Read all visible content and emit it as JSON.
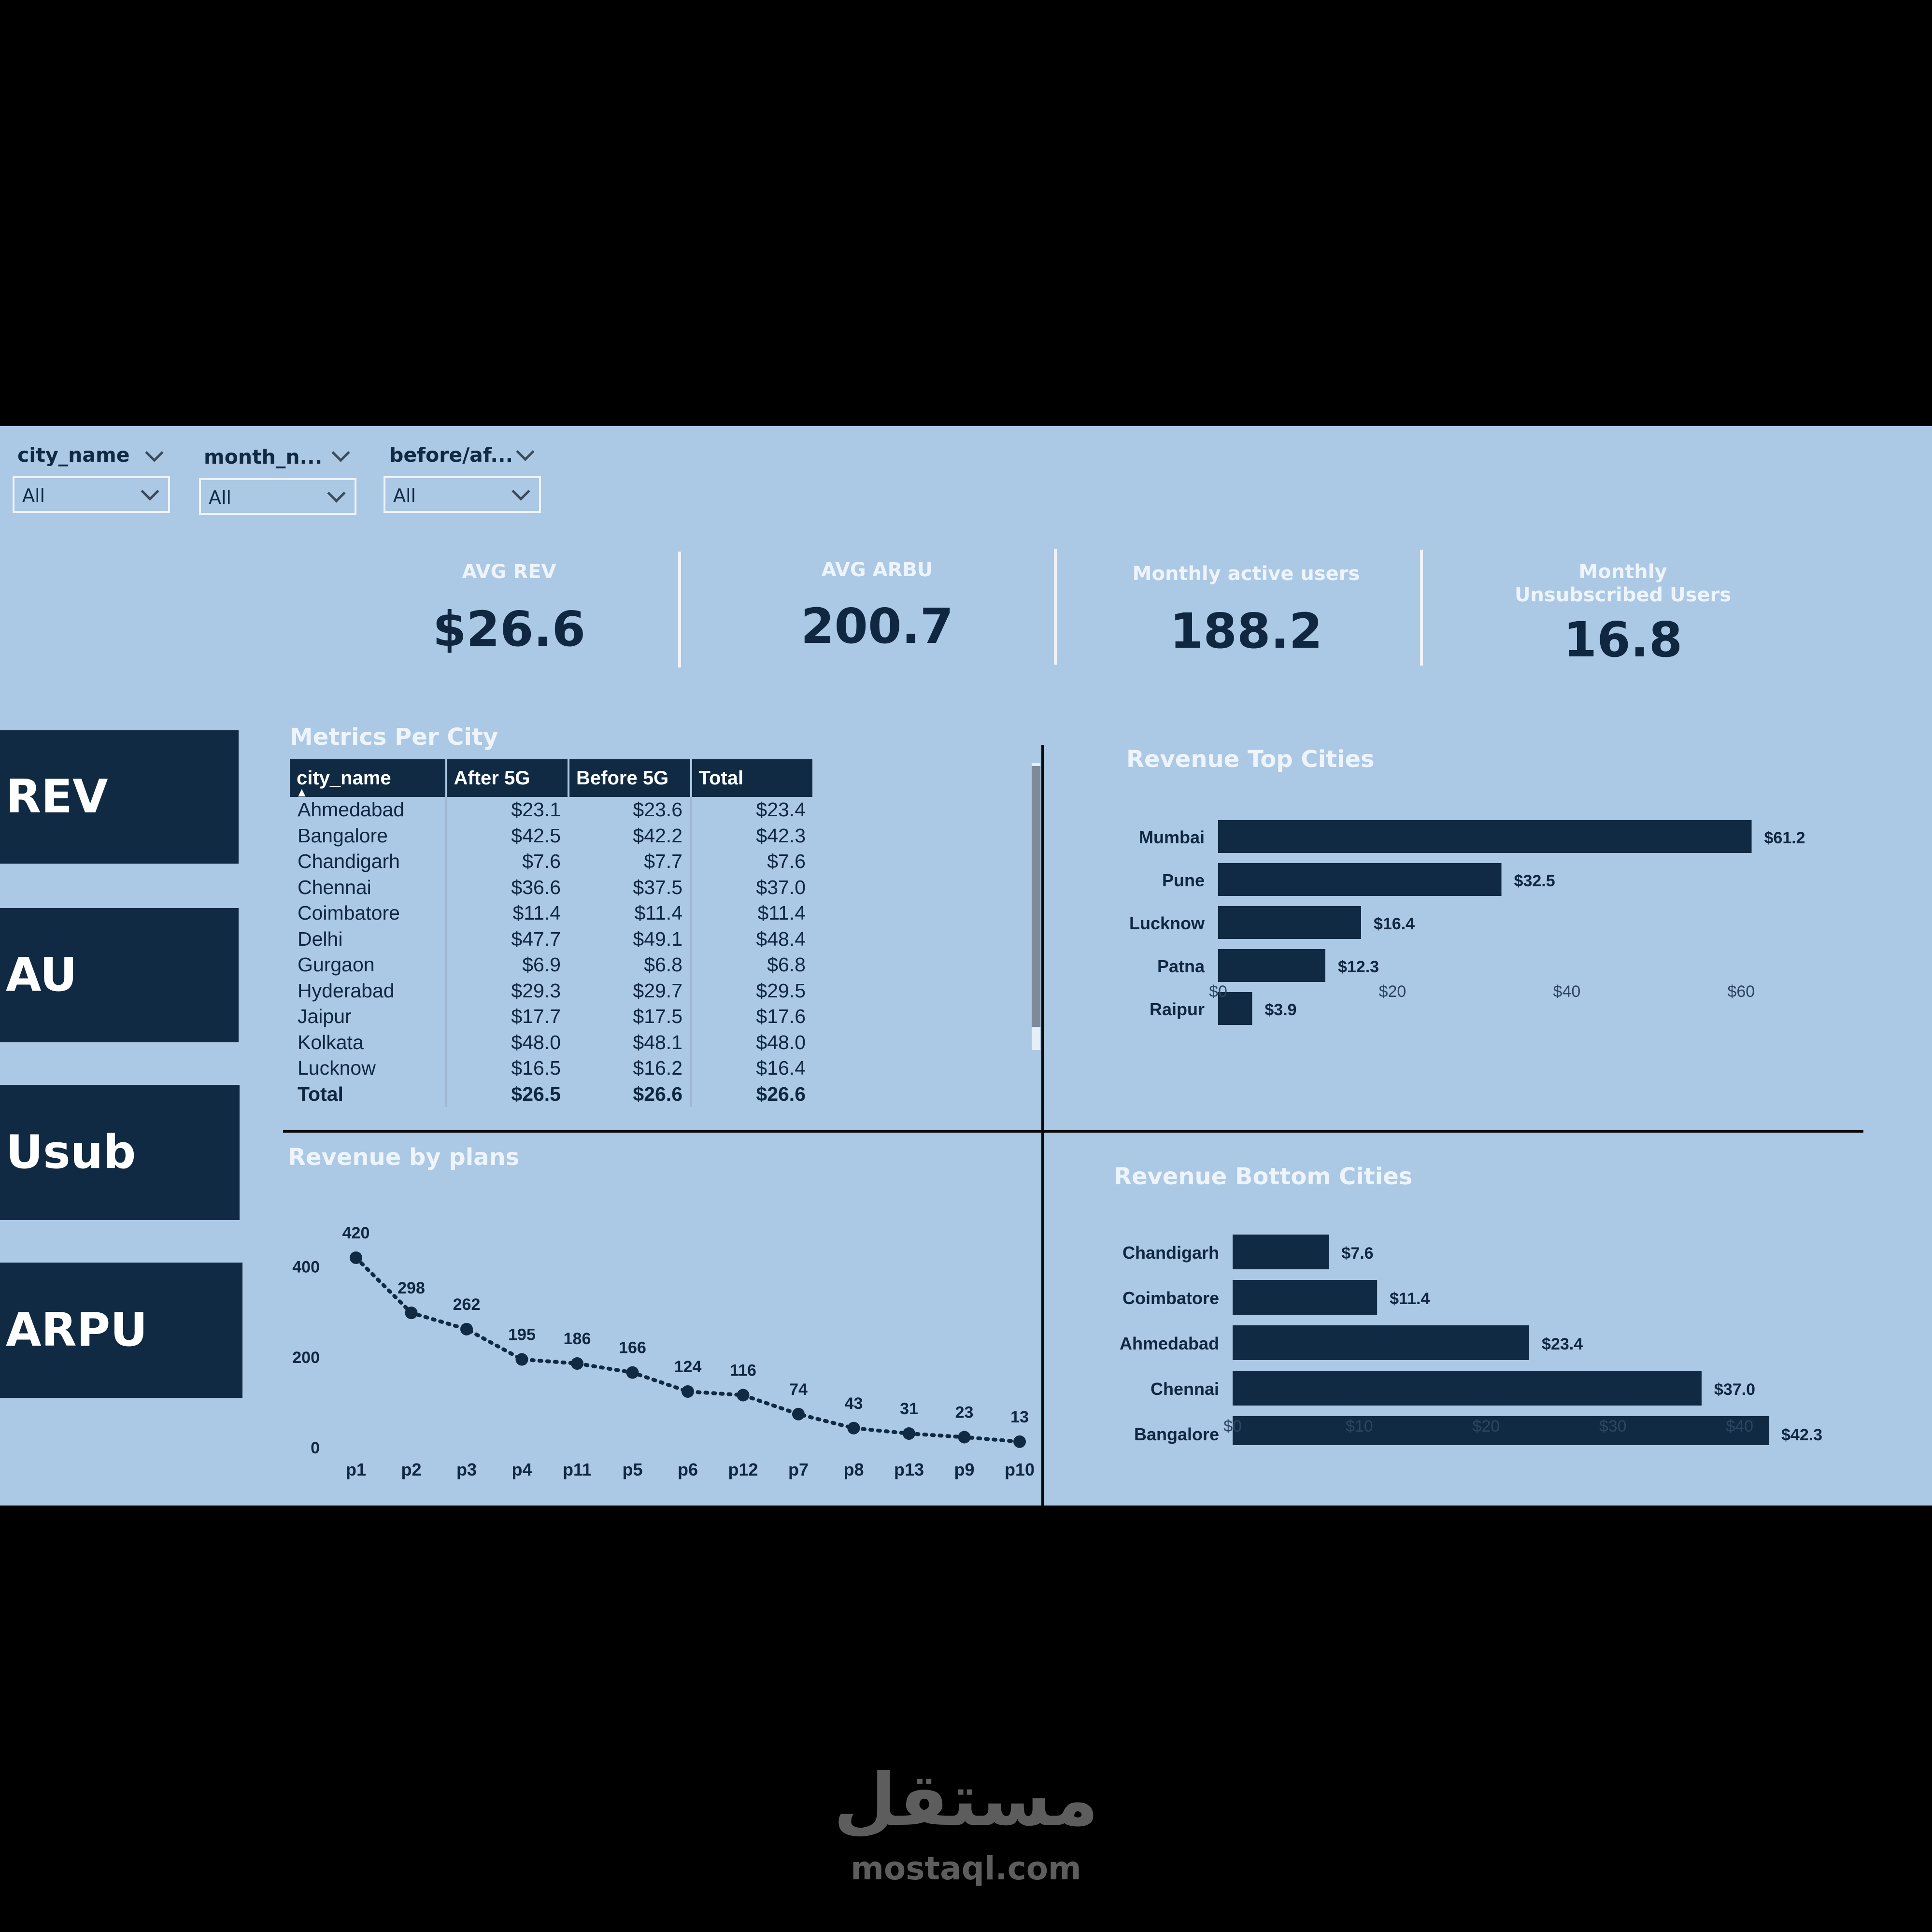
{
  "slicers": [
    {
      "label": "city_name",
      "value": "All"
    },
    {
      "label": "month_n...",
      "value": "All"
    },
    {
      "label": "before/af...",
      "value": "All"
    }
  ],
  "kpis": [
    {
      "label": "AVG REV",
      "value": "$26.6"
    },
    {
      "label": "AVG ARBU",
      "value": "200.7"
    },
    {
      "label": "Monthly active users",
      "value": "188.2"
    },
    {
      "label": "Monthly Unsubscribed Users",
      "value": "16.8"
    }
  ],
  "nav": [
    "REV",
    "AU",
    "Usub",
    "ARPU"
  ],
  "metrics_table": {
    "title": "Metrics Per City",
    "headers": [
      "city_name",
      "After 5G",
      "Before 5G",
      "Total"
    ],
    "sort_indicator": "▲",
    "rows": [
      [
        "Ahmedabad",
        "$23.1",
        "$23.6",
        "$23.4"
      ],
      [
        "Bangalore",
        "$42.5",
        "$42.2",
        "$42.3"
      ],
      [
        "Chandigarh",
        "$7.6",
        "$7.7",
        "$7.6"
      ],
      [
        "Chennai",
        "$36.6",
        "$37.5",
        "$37.0"
      ],
      [
        "Coimbatore",
        "$11.4",
        "$11.4",
        "$11.4"
      ],
      [
        "Delhi",
        "$47.7",
        "$49.1",
        "$48.4"
      ],
      [
        "Gurgaon",
        "$6.9",
        "$6.8",
        "$6.8"
      ],
      [
        "Hyderabad",
        "$29.3",
        "$29.7",
        "$29.5"
      ],
      [
        "Jaipur",
        "$17.7",
        "$17.5",
        "$17.6"
      ],
      [
        "Kolkata",
        "$48.0",
        "$48.1",
        "$48.0"
      ],
      [
        "Lucknow",
        "$16.5",
        "$16.2",
        "$16.4"
      ]
    ],
    "total": [
      "Total",
      "$26.5",
      "$26.6",
      "$26.6"
    ]
  },
  "chart_data": [
    {
      "type": "bar",
      "title": "Revenue Top Cities",
      "orientation": "horizontal",
      "categories": [
        "Mumbai",
        "Pune",
        "Lucknow",
        "Patna",
        "Raipur"
      ],
      "values": [
        61.2,
        32.5,
        16.4,
        12.3,
        3.9
      ],
      "data_labels": [
        "$61.2",
        "$32.5",
        "$16.4",
        "$12.3",
        "$3.9"
      ],
      "x_ticks": [
        "$0",
        "$20",
        "$40",
        "$60"
      ],
      "xlim": [
        0,
        63
      ],
      "color": "#102a43"
    },
    {
      "type": "bar",
      "title": "Revenue Bottom Cities",
      "orientation": "horizontal",
      "categories": [
        "Chandigarh",
        "Coimbatore",
        "Ahmedabad",
        "Chennai",
        "Bangalore"
      ],
      "values": [
        7.6,
        11.4,
        23.4,
        37.0,
        42.3
      ],
      "data_labels": [
        "$7.6",
        "$11.4",
        "$23.4",
        "$37.0",
        "$42.3"
      ],
      "x_ticks": [
        "$0",
        "$10",
        "$20",
        "$30",
        "$40"
      ],
      "xlim": [
        0,
        42.3
      ],
      "color": "#102a43"
    },
    {
      "type": "line",
      "title": "Revenue by plans",
      "categories": [
        "p1",
        "p2",
        "p3",
        "p4",
        "p11",
        "p5",
        "p6",
        "p12",
        "p7",
        "p8",
        "p13",
        "p9",
        "p10"
      ],
      "values": [
        420,
        298,
        262,
        195,
        186,
        166,
        124,
        116,
        74,
        43,
        31,
        23,
        13
      ],
      "y_ticks": [
        "0",
        "200",
        "400"
      ],
      "ylim": [
        0,
        420
      ],
      "line_style": "dotted",
      "color": "#102a43"
    }
  ],
  "watermark": {
    "arabic": "مستقل",
    "latin": "mostaql.com"
  }
}
